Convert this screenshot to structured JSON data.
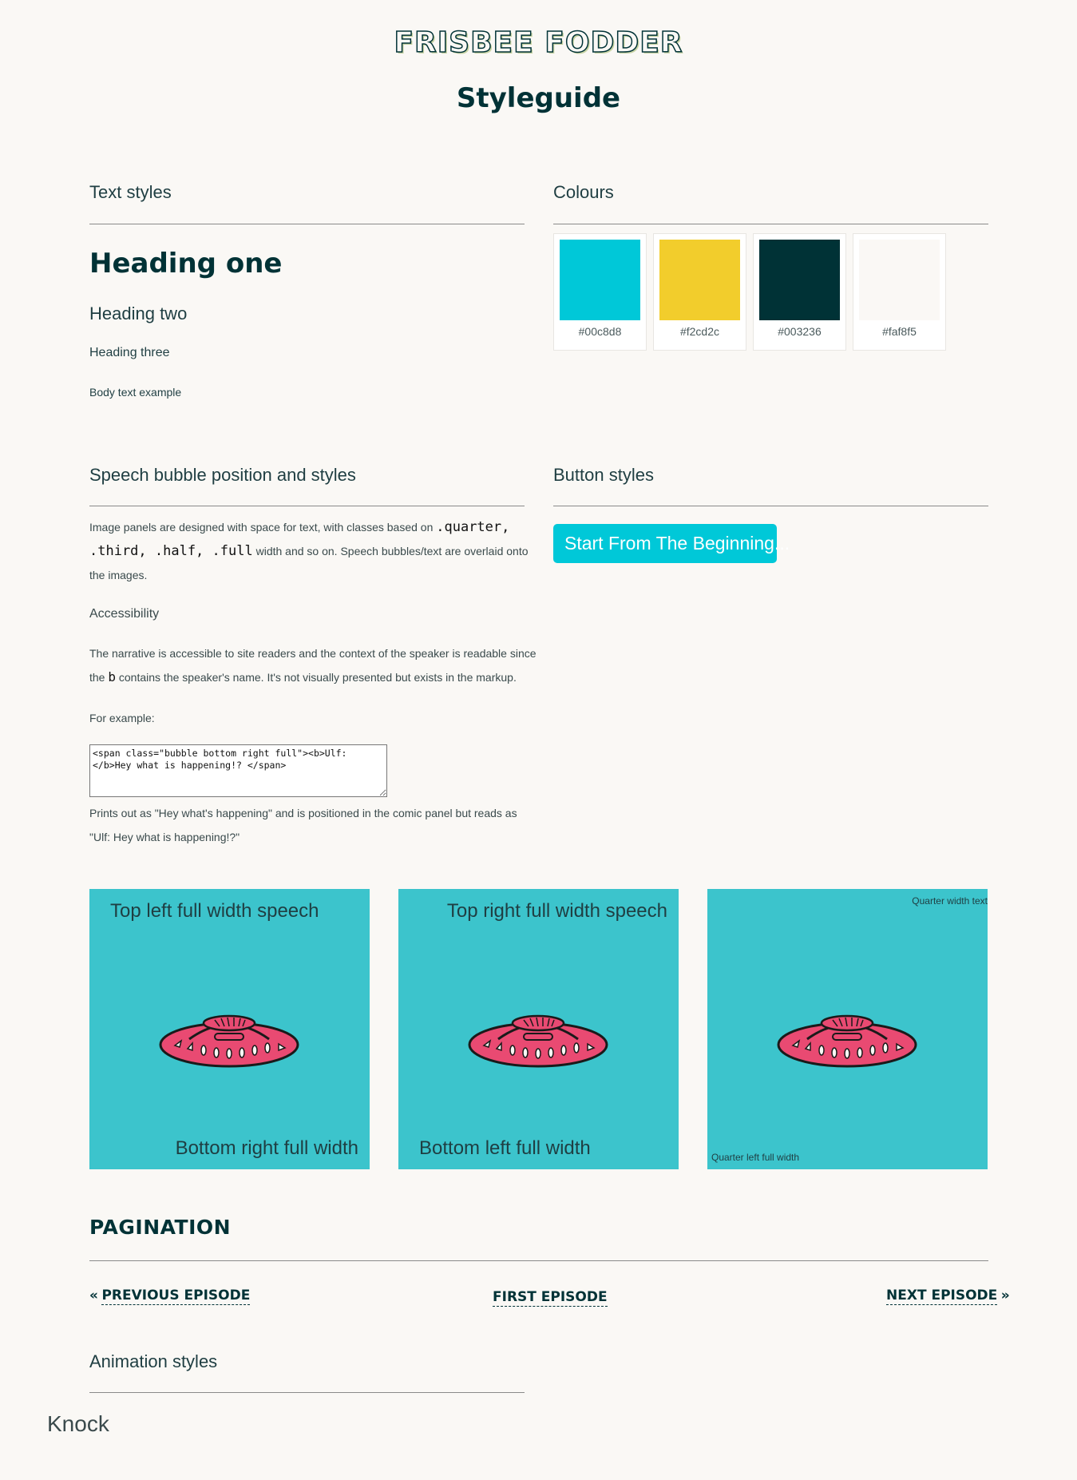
{
  "header": {
    "logo": "FRISBEE FODDER",
    "title": "Styleguide"
  },
  "text_styles": {
    "title": "Text styles",
    "heading_one": "Heading one",
    "heading_two": "Heading two",
    "heading_three": "Heading three",
    "body": "Body text example"
  },
  "colours": {
    "title": "Colours",
    "swatches": [
      {
        "hex": "#00c8d8",
        "color": "#00c8d8"
      },
      {
        "hex": "#f2cd2c",
        "color": "#f2cd2c"
      },
      {
        "hex": "#003236",
        "color": "#003236"
      },
      {
        "hex": "#faf8f5",
        "color": "#faf8f5"
      }
    ]
  },
  "speech": {
    "title": "Speech bubble position and styles",
    "intro_1": "Image panels are designed with space for text, with classes based on",
    "code_1": ".quarter,",
    "code_2": ".third, .half, .full",
    "intro_2": "width and so on. Speech bubbles/text are overlaid onto",
    "intro_3": "the images.",
    "accessibility": "Accessibility",
    "narrative_1": "The narrative is accessible to site readers and the context of the speaker is readable since",
    "narrative_2a": "the",
    "narrative_code": "b",
    "narrative_2b": "contains the speaker's name. It's not visually presented but exists in the markup.",
    "for_example": "For example:",
    "code_example": "<span class=\"bubble bottom right full\"><b>Ulf: </b>Hey what is happening!? </span>",
    "prints_1": "Prints out as \"Hey what's happening\" and is positioned in the comic panel but reads as",
    "prints_2": "\"Ulf: Hey what is happening!?\""
  },
  "buttons": {
    "title": "Button styles",
    "start": "Start From The Beginning..."
  },
  "panels": [
    {
      "top": "Top left full width speech",
      "bottom": "Bottom right full width"
    },
    {
      "top": "Top right full width speech",
      "bottom": "Bottom left full width"
    },
    {
      "top": "Quarter width text",
      "bottom": "Quarter left full width"
    }
  ],
  "pagination": {
    "title": "PAGINATION",
    "prev_arrow": "«",
    "prev": "PREVIOUS EPISODE",
    "first": "FIRST EPISODE",
    "next": "NEXT EPISODE",
    "next_arrow": "»"
  },
  "animation": {
    "title": "Animation styles",
    "knock": "Knock"
  },
  "icons": {
    "panel_image": "frisbee-icon"
  }
}
